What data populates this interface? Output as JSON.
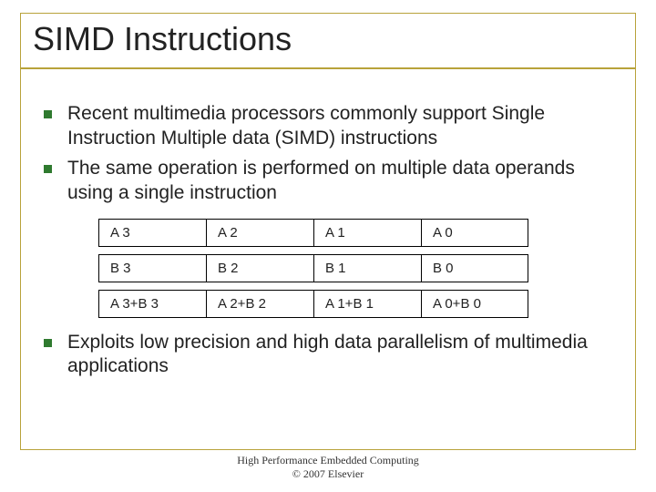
{
  "title": "SIMD Instructions",
  "bullets": [
    "Recent multimedia processors commonly support Single Instruction Multiple data (SIMD) instructions",
    "The same operation is performed on multiple data operands using a single instruction"
  ],
  "table": {
    "rows": [
      [
        "A 3",
        "A 2",
        "A 1",
        "A 0"
      ],
      [
        "B 3",
        "B 2",
        "B 1",
        "B 0"
      ],
      [
        "A 3+B 3",
        "A 2+B 2",
        "A 1+B 1",
        "A 0+B 0"
      ]
    ]
  },
  "bullets_after": [
    "Exploits low precision and high data parallelism of multimedia applications"
  ],
  "footer": {
    "line1": "High Performance Embedded Computing",
    "line2": "© 2007 Elsevier"
  }
}
